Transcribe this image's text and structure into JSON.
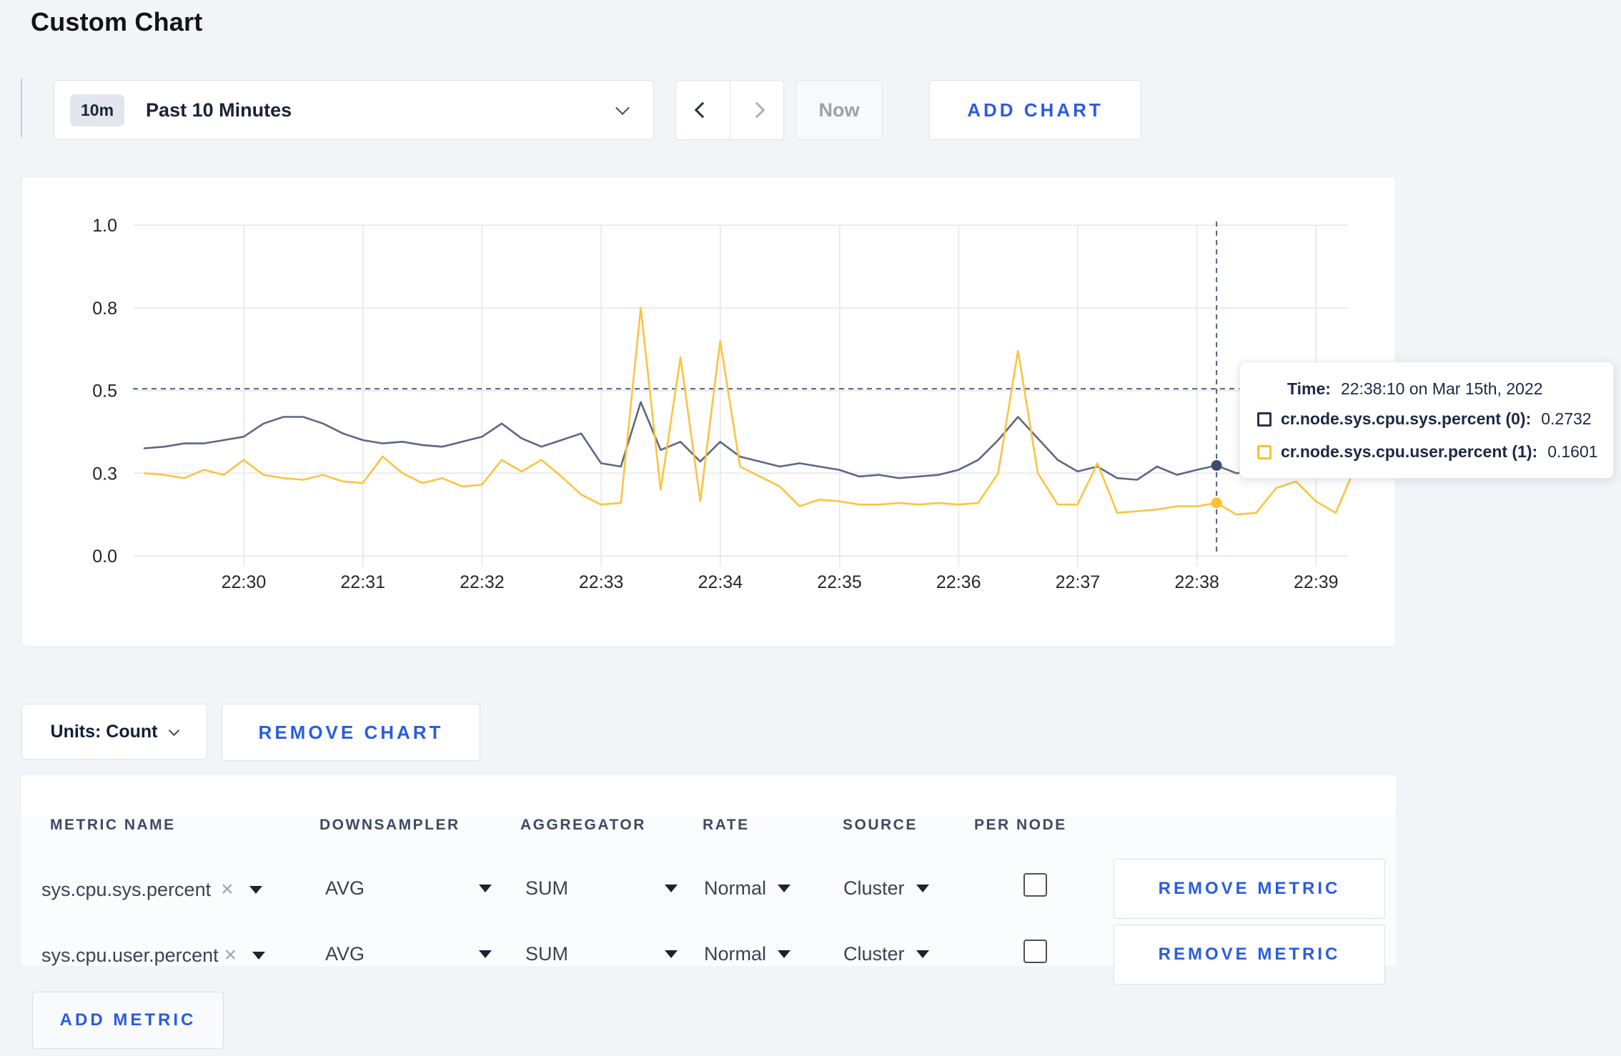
{
  "page": {
    "title": "Custom Chart",
    "background": "#f3f4f7",
    "accent_blue": "#2b5ce0"
  },
  "toolbar": {
    "time_range": {
      "badge": "10m",
      "label": "Past 10 Minutes"
    },
    "now_label": "Now",
    "add_chart_label": "ADD CHART"
  },
  "chart_data": {
    "type": "line",
    "title": "",
    "xlabel": "",
    "ylabel": "",
    "ylim": [
      0,
      1
    ],
    "grid": true,
    "x_start": "22:29:10",
    "x_step_seconds": 10,
    "x_ticks": [
      "22:30",
      "22:31",
      "22:32",
      "22:33",
      "22:34",
      "22:35",
      "22:36",
      "22:37",
      "22:38",
      "22:39"
    ],
    "y_ticks": [
      {
        "label": "1.0",
        "value": 1.0
      },
      {
        "label": "0.8",
        "value": 0.75
      },
      {
        "label": "0.5",
        "value": 0.5
      },
      {
        "label": "0.3",
        "value": 0.25
      },
      {
        "label": "0.0",
        "value": 0.0
      }
    ],
    "series": [
      {
        "name": "cr.node.sys.cpu.sys.percent",
        "color": "#5c6785",
        "dot_color": "#3c4a6d",
        "values": [
          0.325,
          0.33,
          0.34,
          0.34,
          0.35,
          0.36,
          0.4,
          0.42,
          0.42,
          0.4,
          0.37,
          0.35,
          0.34,
          0.345,
          0.335,
          0.33,
          0.345,
          0.36,
          0.4,
          0.355,
          0.33,
          0.35,
          0.37,
          0.28,
          0.27,
          0.465,
          0.32,
          0.345,
          0.285,
          0.345,
          0.3,
          0.285,
          0.27,
          0.28,
          0.27,
          0.26,
          0.24,
          0.245,
          0.235,
          0.24,
          0.245,
          0.26,
          0.29,
          0.35,
          0.42,
          0.355,
          0.29,
          0.255,
          0.27,
          0.235,
          0.23,
          0.27,
          0.245,
          0.26,
          0.2732,
          0.25,
          0.255,
          0.26,
          0.24,
          0.25,
          0.285,
          0.3
        ]
      },
      {
        "name": "cr.node.sys.cpu.user.percent",
        "color": "#fbc43f",
        "dot_color": "#fdc02f",
        "values": [
          0.25,
          0.245,
          0.235,
          0.26,
          0.245,
          0.29,
          0.245,
          0.235,
          0.23,
          0.245,
          0.225,
          0.22,
          0.3,
          0.25,
          0.22,
          0.235,
          0.21,
          0.215,
          0.29,
          0.255,
          0.29,
          0.24,
          0.185,
          0.155,
          0.16,
          0.75,
          0.2,
          0.6,
          0.165,
          0.65,
          0.27,
          0.24,
          0.21,
          0.15,
          0.17,
          0.165,
          0.155,
          0.155,
          0.16,
          0.155,
          0.16,
          0.155,
          0.16,
          0.25,
          0.62,
          0.25,
          0.155,
          0.155,
          0.28,
          0.13,
          0.135,
          0.14,
          0.15,
          0.15,
          0.1601,
          0.125,
          0.13,
          0.205,
          0.225,
          0.165,
          0.13,
          0.27
        ]
      }
    ],
    "crosshair": {
      "x_index": 54,
      "hline_value": 0.505,
      "color": "#50617c"
    },
    "legend_position": "tooltip"
  },
  "tooltip": {
    "time_label": "Time:",
    "time_value": "22:38:10 on Mar 15th, 2022",
    "rows": [
      {
        "label": "cr.node.sys.cpu.sys.percent (0):",
        "value": "0.2732",
        "swatch_color": "#26324e"
      },
      {
        "label": "cr.node.sys.cpu.user.percent (1):",
        "value": "0.1601",
        "swatch_color": "#fdc02f"
      }
    ]
  },
  "units": {
    "label": "Units: Count"
  },
  "remove_chart_label": "REMOVE CHART",
  "metrics_table": {
    "columns": [
      "METRIC NAME",
      "DOWNSAMPLER",
      "AGGREGATOR",
      "RATE",
      "SOURCE",
      "PER NODE"
    ],
    "rows": [
      {
        "metric": "sys.cpu.sys.percent",
        "downsampler": "AVG",
        "aggregator": "SUM",
        "rate": "Normal",
        "source": "Cluster",
        "per_node_checked": false
      },
      {
        "metric": "sys.cpu.user.percent",
        "downsampler": "AVG",
        "aggregator": "SUM",
        "rate": "Normal",
        "source": "Cluster",
        "per_node_checked": false
      }
    ],
    "remove_metric_label": "REMOVE METRIC",
    "add_metric_label": "ADD METRIC",
    "close_glyph": "×"
  }
}
